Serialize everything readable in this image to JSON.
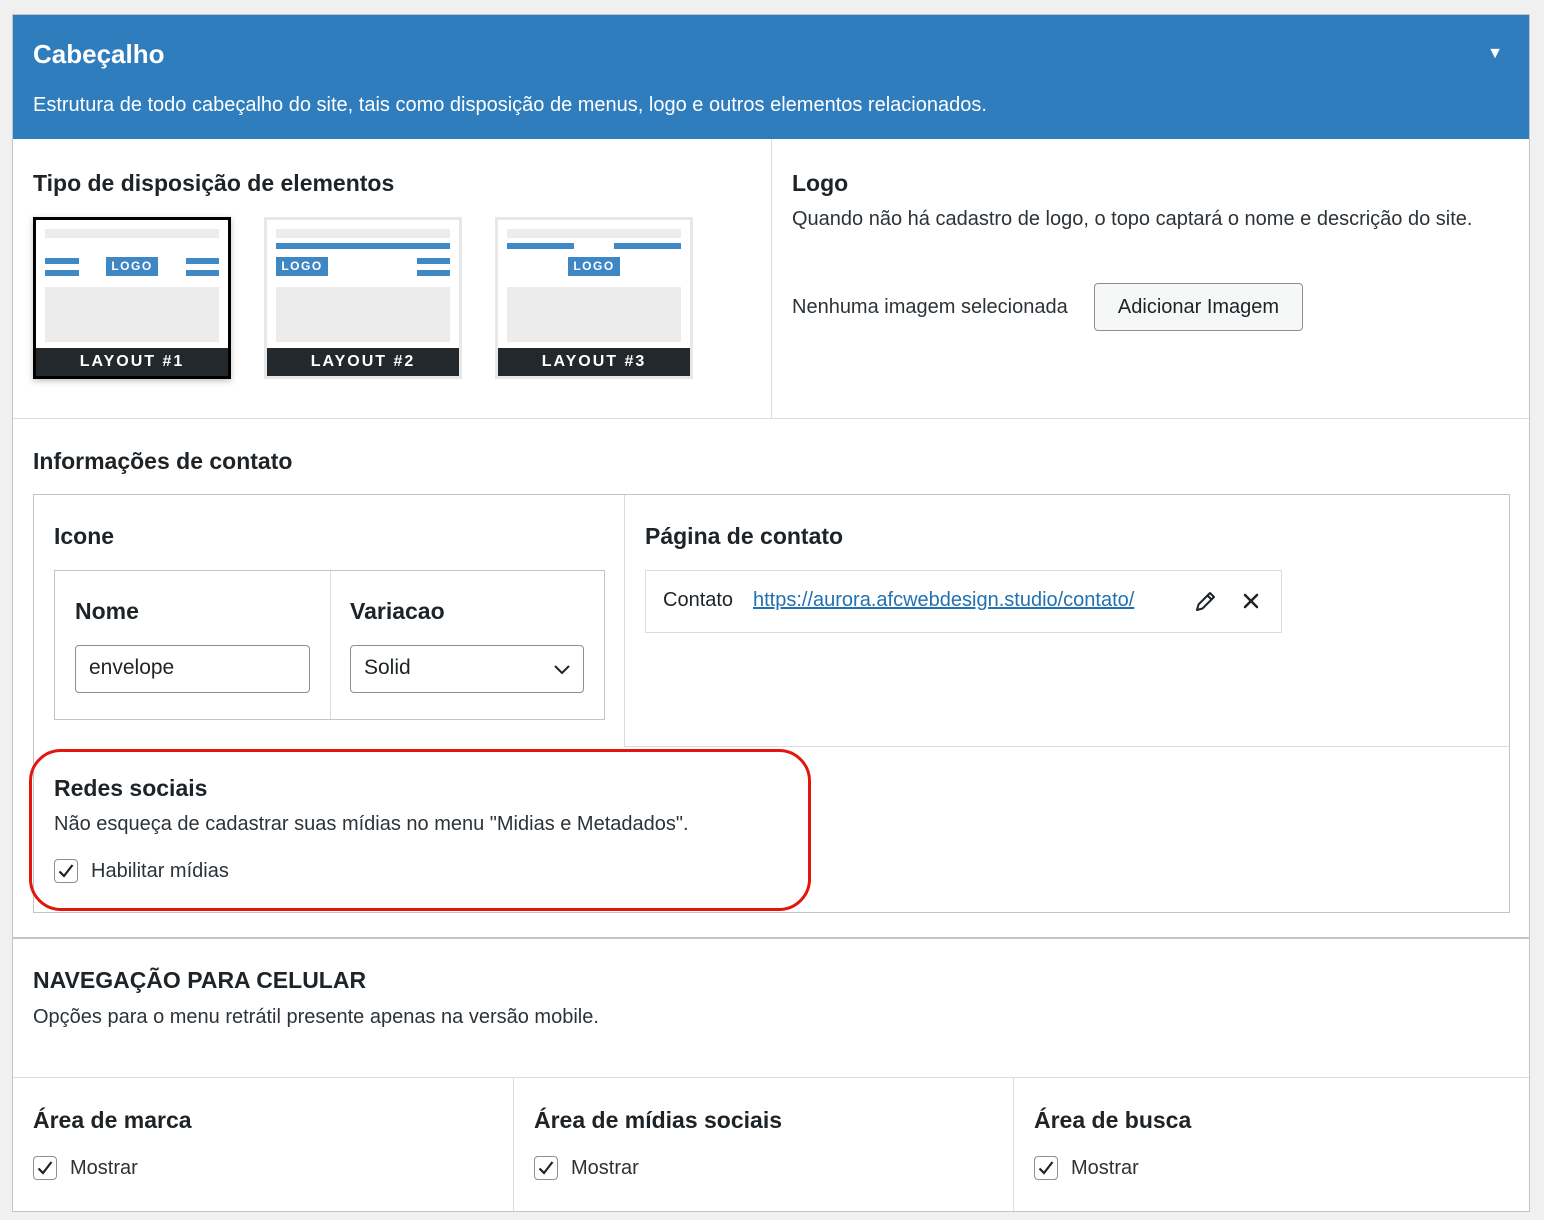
{
  "header": {
    "title": "Cabeçalho",
    "description": "Estrutura de todo cabeçalho do site, tais como disposição de menus, logo e outros elementos relacionados.",
    "toggle_icon": "▼"
  },
  "layout_section": {
    "title": "Tipo de disposição de elementos",
    "logo_badge": "LOGO",
    "options": [
      {
        "label": "LAYOUT #1",
        "selected": true
      },
      {
        "label": "LAYOUT #2",
        "selected": false
      },
      {
        "label": "LAYOUT #3",
        "selected": false
      }
    ]
  },
  "logo_section": {
    "title": "Logo",
    "description": "Quando não há cadastro de logo, o topo captará o nome e descrição do site.",
    "status": "Nenhuma imagem selecionada",
    "add_button": "Adicionar Imagem"
  },
  "contact_section": {
    "title": "Informações de contato",
    "icon_group": {
      "title": "Icone",
      "name_label": "Nome",
      "name_value": "envelope",
      "variation_label": "Variacao",
      "variation_value": "Solid"
    },
    "contact_page": {
      "title": "Página de contato",
      "link_title": "Contato",
      "link_url": "https://aurora.afcwebdesign.studio/contato/"
    },
    "social": {
      "title": "Redes sociais",
      "description": "Não esqueça de cadastrar suas mídias no menu \"Midias e Metadados\".",
      "checkbox_label": "Habilitar mídias",
      "checked": true
    }
  },
  "mobile_nav": {
    "title": "NAVEGAÇÃO PARA CELULAR",
    "description": "Opções para o menu retrátil presente apenas na versão mobile.",
    "areas": [
      {
        "title": "Área de marca",
        "checkbox_label": "Mostrar",
        "checked": true
      },
      {
        "title": "Área de mídias sociais",
        "checkbox_label": "Mostrar",
        "checked": true
      },
      {
        "title": "Área de busca",
        "checkbox_label": "Mostrar",
        "checked": true
      }
    ]
  },
  "colors": {
    "header_bg": "#2f7dbd",
    "accent_link": "#2271b1",
    "highlight_red": "#e3150d"
  }
}
